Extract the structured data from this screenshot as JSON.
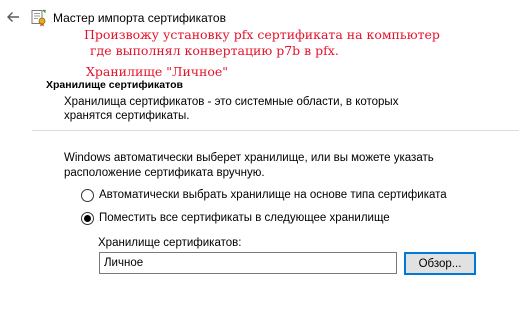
{
  "window": {
    "title": "Мастер импорта сертификатов",
    "back_icon": "back-arrow-icon",
    "wizard_icon": "certificate-wizard-icon"
  },
  "annotation": {
    "color": "#e3122a",
    "line1": "Произвожу установку pfx сертификата на компьютер",
    "line2": "где выполнял конвертацию p7b в pfx.",
    "line3": "Хранилище \"Личное\""
  },
  "header": {
    "title": "Хранилище сертификатов",
    "description": "Хранилища сертификатов - это системные области, в которых хранятся сертификаты."
  },
  "body": {
    "intro": "Windows автоматически выберет хранилище, или вы можете указать расположение сертификата вручную.",
    "options": [
      {
        "label": "Автоматически выбрать хранилище на основе типа сертификата",
        "selected": false
      },
      {
        "label": "Поместить все сертификаты в следующее хранилище",
        "selected": true
      }
    ],
    "store_label": "Хранилище сертификатов:",
    "store_value": "Личное",
    "browse_label": "Обзор..."
  },
  "colors": {
    "accent": "#0078d7"
  }
}
